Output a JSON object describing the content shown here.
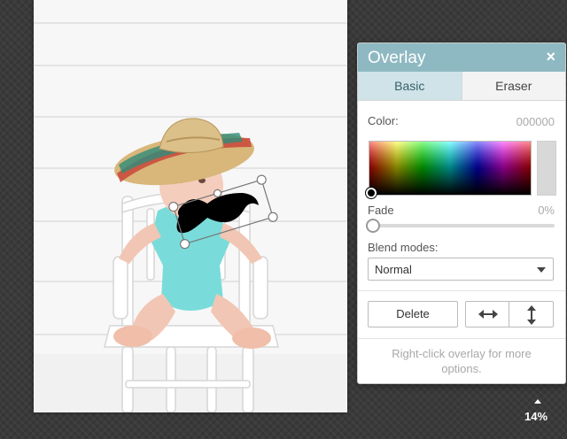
{
  "overlay_panel": {
    "title": "Overlay",
    "close_symbol": "×",
    "tabs": [
      {
        "label": "Basic",
        "active": true
      },
      {
        "label": "Eraser",
        "active": false
      }
    ],
    "color_label": "Color:",
    "color_value": "000000",
    "fade_label": "Fade",
    "fade_value": "0%",
    "blend_label": "Blend modes:",
    "blend_selected": "Normal",
    "delete_label": "Delete",
    "flip_horizontal_icon": "flip-horizontal-icon",
    "flip_vertical_icon": "flip-vertical-icon",
    "help_text": "Right-click overlay for more options."
  },
  "zoom": {
    "label": "14%"
  },
  "colors": {
    "panel_header": "#8fb9c2",
    "active_tab": "#cfe3e8",
    "workspace": "#3a3a3a"
  }
}
